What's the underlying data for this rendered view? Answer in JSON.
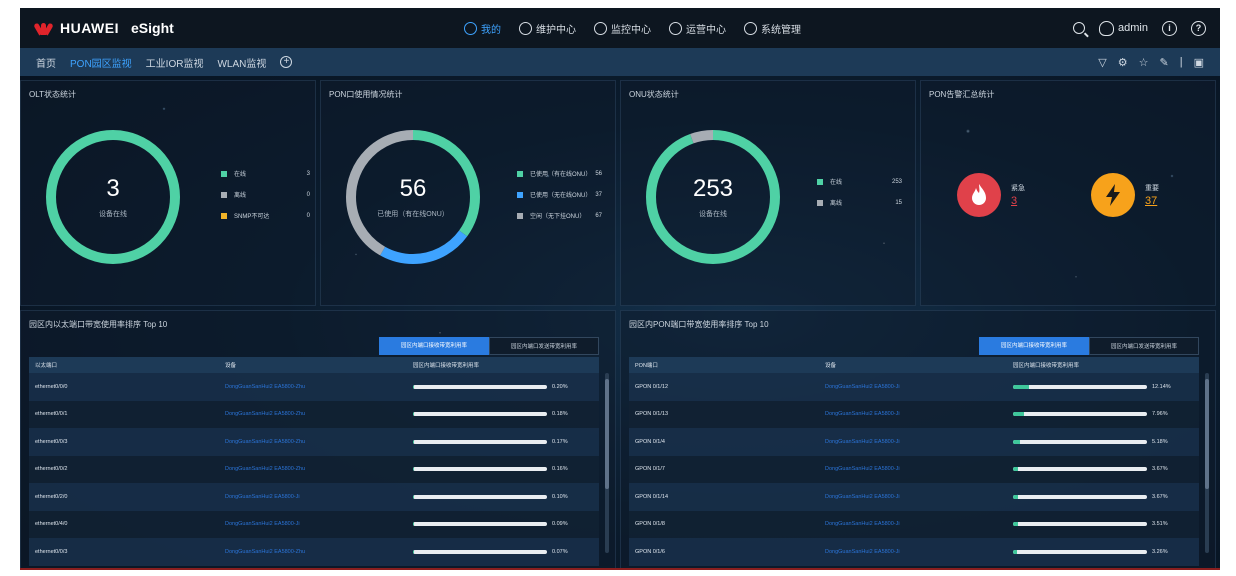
{
  "header": {
    "brand": "HUAWEI",
    "product": "eSight",
    "nav": [
      {
        "label": "我的",
        "active": true
      },
      {
        "label": "维护中心",
        "active": false
      },
      {
        "label": "监控中心",
        "active": false
      },
      {
        "label": "运营中心",
        "active": false
      },
      {
        "label": "系统管理",
        "active": false
      }
    ],
    "user": "admin"
  },
  "tabs": [
    {
      "label": "首页",
      "active": false
    },
    {
      "label": "PON园区监视",
      "active": true
    },
    {
      "label": "工业IOR监视",
      "active": false
    },
    {
      "label": "WLAN监视",
      "active": false
    }
  ],
  "olt": {
    "title": "OLT状态统计",
    "value": "3",
    "sub": "设备在线",
    "legend": [
      {
        "label": "在线",
        "value": "3",
        "color": "#4fd1a5"
      },
      {
        "label": "离线",
        "value": "0",
        "color": "#a7adb4"
      },
      {
        "label": "SNMP不可达",
        "value": "0",
        "color": "#f2b428"
      }
    ]
  },
  "pon": {
    "title": "PON口使用情况统计",
    "value": "56",
    "sub": "已使用（有在线ONU）",
    "legend": [
      {
        "label": "已使用（有在线ONU）",
        "value": "56",
        "color": "#4fd1a5"
      },
      {
        "label": "已使用（无在线ONU）",
        "value": "37",
        "color": "#3ea3ff"
      },
      {
        "label": "空闲（无下挂ONU）",
        "value": "67",
        "color": "#a7adb4"
      }
    ],
    "slices": [
      56,
      37,
      67
    ]
  },
  "onu": {
    "title": "ONU状态统计",
    "value": "253",
    "sub": "设备在线",
    "legend": [
      {
        "label": "在线",
        "value": "253",
        "color": "#4fd1a5"
      },
      {
        "label": "离线",
        "value": "15",
        "color": "#a7adb4"
      }
    ],
    "slices": [
      253,
      15
    ]
  },
  "ponalarm": {
    "title": "PON告警汇总统计",
    "items": [
      {
        "label": "紧急",
        "value": "3",
        "color": "#e0414a"
      },
      {
        "label": "重要",
        "value": "37",
        "color": "#f7a21b"
      }
    ]
  },
  "eth": {
    "title": "园区内以太端口带宽使用率排序 Top 10",
    "toggle": [
      "园区内端口接收带宽利用率",
      "园区内端口发送带宽利用率"
    ],
    "headers": [
      "以太端口",
      "设备",
      "园区内端口接收带宽利用率"
    ],
    "rows": [
      {
        "port": "ethernet0/0/0",
        "device": "DongGuanSanHui2 EA5800-Zhu",
        "rate": "0.20%",
        "pct": 0.2
      },
      {
        "port": "ethernet0/0/1",
        "device": "DongGuanSanHui2 EA5800-Zhu",
        "rate": "0.18%",
        "pct": 0.18
      },
      {
        "port": "ethernet0/0/3",
        "device": "DongGuanSanHui2 EA5800-Zhu",
        "rate": "0.17%",
        "pct": 0.17
      },
      {
        "port": "ethernet0/0/2",
        "device": "DongGuanSanHui2 EA5800-Zhu",
        "rate": "0.16%",
        "pct": 0.16
      },
      {
        "port": "ethernet0/2/0",
        "device": "DongGuanSanHui2 EA5800-Ji",
        "rate": "0.10%",
        "pct": 0.1
      },
      {
        "port": "ethernet0/4/0",
        "device": "DongGuanSanHui2 EA5800-Ji",
        "rate": "0.09%",
        "pct": 0.09
      },
      {
        "port": "ethernet0/0/3",
        "device": "DongGuanSanHui2 EA5800-Zhu",
        "rate": "0.07%",
        "pct": 0.07
      }
    ]
  },
  "ponport": {
    "title": "园区内PON端口带宽使用率排序 Top 10",
    "toggle": [
      "园区内端口接收带宽利用率",
      "园区内端口发送带宽利用率"
    ],
    "headers": [
      "PON端口",
      "设备",
      "园区内端口接收带宽利用率"
    ],
    "rows": [
      {
        "port": "GPON 0/1/12",
        "device": "DongGuanSanHui2 EA5800-Ji",
        "rate": "12.14%",
        "pct": 12.14
      },
      {
        "port": "GPON 0/1/13",
        "device": "DongGuanSanHui2 EA5800-Ji",
        "rate": "7.96%",
        "pct": 7.96
      },
      {
        "port": "GPON 0/1/4",
        "device": "DongGuanSanHui2 EA5800-Ji",
        "rate": "5.18%",
        "pct": 5.18
      },
      {
        "port": "GPON 0/1/7",
        "device": "DongGuanSanHui2 EA5800-Ji",
        "rate": "3.67%",
        "pct": 3.67
      },
      {
        "port": "GPON 0/1/14",
        "device": "DongGuanSanHui2 EA5800-Ji",
        "rate": "3.67%",
        "pct": 3.67
      },
      {
        "port": "GPON 0/1/8",
        "device": "DongGuanSanHui2 EA5800-Ji",
        "rate": "3.51%",
        "pct": 3.51
      },
      {
        "port": "GPON 0/1/6",
        "device": "DongGuanSanHui2 EA5800-Ji",
        "rate": "3.26%",
        "pct": 3.26
      }
    ]
  }
}
